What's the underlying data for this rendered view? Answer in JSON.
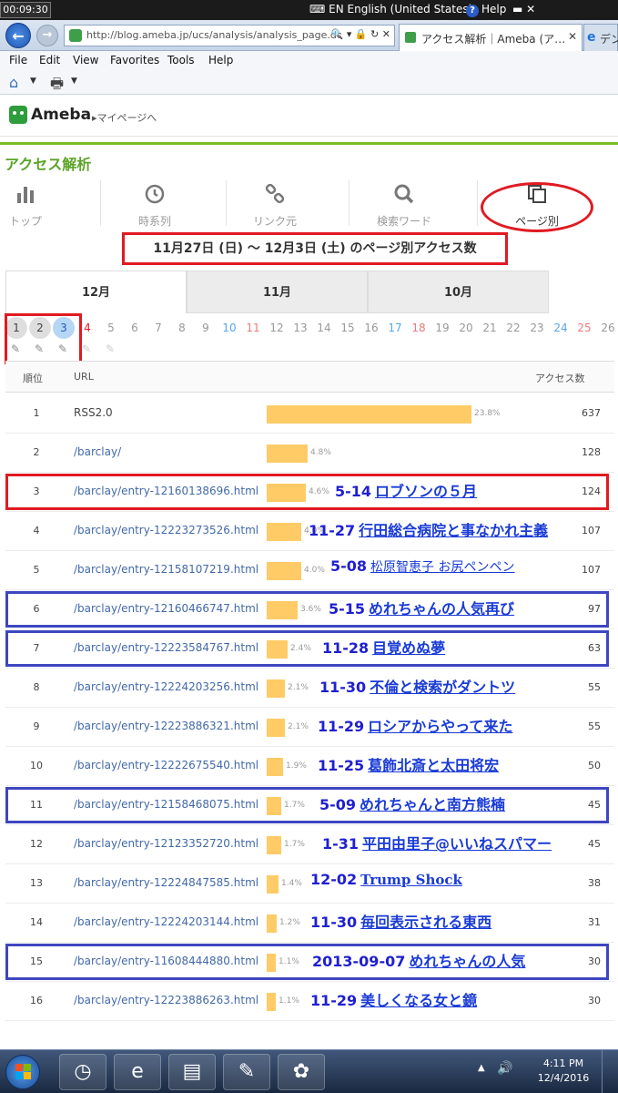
{
  "titlebar": {
    "clock": "00:09:30",
    "language": "EN English (United States)",
    "help": "Help",
    "help_icon": "?",
    "window_controls": "▬ ✕"
  },
  "browser": {
    "back_icon": "←",
    "forward_icon": "→",
    "address": "http://blog.ameba.jp/ucs/analysis/analysis_page.do",
    "address_tools": "🔍 ▾ 🔒 ↻ ✕",
    "tab_active": "アクセス解析｜Ameba (ア…",
    "tab_close": "✕",
    "tab_other": "デン",
    "tab_other_icon": "e",
    "menu": [
      "File",
      "Edit",
      "View",
      "Favorites",
      "Tools",
      "Help"
    ],
    "home_icon": "⌂",
    "print_icon": "🖶",
    "dropdown_icon": "▼"
  },
  "header": {
    "logo": "Ameba",
    "mypage": "▸マイページへ"
  },
  "section": {
    "title": "アクセス解析"
  },
  "tabs": [
    {
      "id": "top",
      "label": "トップ",
      "icon": "bar-chart-icon",
      "glyph": "▮"
    },
    {
      "id": "time",
      "label": "時系列",
      "icon": "clock-icon",
      "glyph": "◷"
    },
    {
      "id": "link",
      "label": "リンク元",
      "icon": "link-icon",
      "glyph": "⚯"
    },
    {
      "id": "search",
      "label": "検索ワード",
      "icon": "search-icon",
      "glyph": "🔍"
    },
    {
      "id": "page",
      "label": "ページ別",
      "icon": "pages-icon",
      "glyph": "❐"
    }
  ],
  "period_heading": "11月27日 (日) 〜 12月3日 (土) のページ別アクセス数",
  "months": [
    "12月",
    "11月",
    "10月"
  ],
  "days": [
    "1",
    "2",
    "3",
    "4",
    "5",
    "6",
    "7",
    "8",
    "9",
    "10",
    "11",
    "12",
    "13",
    "14",
    "15",
    "16",
    "17",
    "18",
    "19",
    "20",
    "21",
    "22",
    "23",
    "24",
    "25",
    "26"
  ],
  "pencil_icon": "✎",
  "table": {
    "col_rank": "順位",
    "col_url": "URL",
    "col_count": "アクセス数",
    "rows": [
      {
        "rank": "1",
        "url": "RSS2.0",
        "pct": "23.8%",
        "count": "637",
        "note_date": "",
        "note_title": ""
      },
      {
        "rank": "2",
        "url": "/barclay/",
        "pct": "4.8%",
        "count": "128",
        "note_date": "",
        "note_title": ""
      },
      {
        "rank": "3",
        "url": "/barclay/entry-12160138696.html",
        "pct": "4.6%",
        "count": "124",
        "note_date": "5-14",
        "note_title": "ロブソンの５月"
      },
      {
        "rank": "4",
        "url": "/barclay/entry-12223273526.html",
        "pct": "4.0%",
        "count": "107",
        "note_date": "11-27",
        "note_title": "行田総合病院と事なかれ主義"
      },
      {
        "rank": "5",
        "url": "/barclay/entry-12158107219.html",
        "pct": "4.0%",
        "count": "107",
        "note_date": "5-08",
        "note_title": "松原智恵子 お尻ペンペン"
      },
      {
        "rank": "6",
        "url": "/barclay/entry-12160466747.html",
        "pct": "3.6%",
        "count": "97",
        "note_date": "5-15",
        "note_title": "めれちゃんの人気再び"
      },
      {
        "rank": "7",
        "url": "/barclay/entry-12223584767.html",
        "pct": "2.4%",
        "count": "63",
        "note_date": "11-28",
        "note_title": "目覚めぬ夢"
      },
      {
        "rank": "8",
        "url": "/barclay/entry-12224203256.html",
        "pct": "2.1%",
        "count": "55",
        "note_date": "11-30",
        "note_title": "不倫と検索がダントツ"
      },
      {
        "rank": "9",
        "url": "/barclay/entry-12223886321.html",
        "pct": "2.1%",
        "count": "55",
        "note_date": "11-29",
        "note_title": "ロシアからやって来た"
      },
      {
        "rank": "10",
        "url": "/barclay/entry-12222675540.html",
        "pct": "1.9%",
        "count": "50",
        "note_date": "11-25",
        "note_title": "葛飾北斎と太田将宏"
      },
      {
        "rank": "11",
        "url": "/barclay/entry-12158468075.html",
        "pct": "1.7%",
        "count": "45",
        "note_date": "5-09",
        "note_title": "めれちゃんと南方熊楠"
      },
      {
        "rank": "12",
        "url": "/barclay/entry-12123352720.html",
        "pct": "1.7%",
        "count": "45",
        "note_date": "1-31",
        "note_title": "平田由里子@いいねスパマー"
      },
      {
        "rank": "13",
        "url": "/barclay/entry-12224847585.html",
        "pct": "1.4%",
        "count": "38",
        "note_date": "12-02",
        "note_title": "Trump Shock"
      },
      {
        "rank": "14",
        "url": "/barclay/entry-12224203144.html",
        "pct": "1.2%",
        "count": "31",
        "note_date": "11-30",
        "note_title": "毎回表示される東西"
      },
      {
        "rank": "15",
        "url": "/barclay/entry-11608444880.html",
        "pct": "1.1%",
        "count": "30",
        "note_date": "2013-09-07",
        "note_title": "めれちゃんの人気"
      },
      {
        "rank": "16",
        "url": "/barclay/entry-12223886263.html",
        "pct": "1.1%",
        "count": "30",
        "note_date": "11-29",
        "note_title": "美しくなる女と鏡"
      }
    ]
  },
  "taskbar": {
    "tray_up": "▲",
    "tray_volume": "🔊",
    "time": "4:11 PM",
    "date": "12/4/2016",
    "apps": [
      {
        "name": "clock-app",
        "glyph": "◷"
      },
      {
        "name": "ie-app",
        "glyph": "e"
      },
      {
        "name": "explorer-app",
        "glyph": "▤"
      },
      {
        "name": "notepad-app",
        "glyph": "✎"
      },
      {
        "name": "paint-app",
        "glyph": "✿"
      }
    ]
  },
  "colors": {
    "ameba_green": "#5ca427",
    "bar": "#fecb66",
    "annotation_red": "#e01a22",
    "annotation_blue": "#3e46c0",
    "note_text": "#1f1fd0"
  }
}
